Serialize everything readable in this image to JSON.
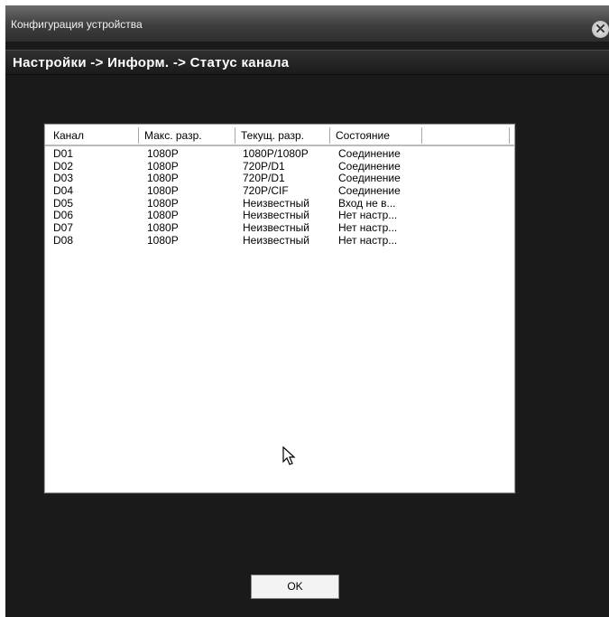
{
  "window": {
    "title": "Конфигурация устройства",
    "close_icon": "close-icon"
  },
  "breadcrumb": "Настройки -> Информ. -> Статус канала",
  "table": {
    "columns": [
      "Канал",
      "Макс. разр.",
      "Текущ. разр.",
      "Состояние",
      ""
    ],
    "rows": [
      [
        "D01",
        "1080P",
        "1080P/1080P",
        "Соединение"
      ],
      [
        "D02",
        "1080P",
        "720P/D1",
        "Соединение"
      ],
      [
        "D03",
        "1080P",
        "720P/D1",
        "Соединение"
      ],
      [
        "D04",
        "1080P",
        "720P/CIF",
        "Соединение"
      ],
      [
        "D05",
        "1080P",
        "Неизвестный",
        "Вход не в..."
      ],
      [
        "D06",
        "1080P",
        "Неизвестный",
        "Нет настр..."
      ],
      [
        "D07",
        "1080P",
        "Неизвестный",
        "Нет настр..."
      ],
      [
        "D08",
        "1080P",
        "Неизвестный",
        "Нет настр..."
      ]
    ]
  },
  "buttons": {
    "ok": "OK"
  },
  "colors": {
    "window_bg": "#1a1a1a",
    "titlebar": "#4a4a4a",
    "table_bg": "#ffffff"
  }
}
